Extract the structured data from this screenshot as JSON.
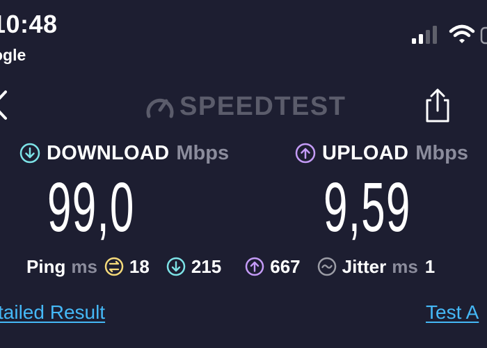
{
  "status_bar": {
    "time": "10:48",
    "carrier": "ogle"
  },
  "header": {
    "logo_text": "SPEEDTEST"
  },
  "download": {
    "title": "DOWNLOAD",
    "unit": "Mbps",
    "value": "99,0",
    "color": "#7de3e7"
  },
  "upload": {
    "title": "UPLOAD",
    "unit": "Mbps",
    "value": "9,59",
    "color": "#c49bf7"
  },
  "stats": {
    "ping_label": "Ping",
    "ping_unit": "ms",
    "ping_idle": "18",
    "ping_download": "215",
    "ping_upload": "667",
    "jitter_label": "Jitter",
    "jitter_unit": "ms",
    "jitter_value": "1",
    "idle_color": "#f5da7a"
  },
  "links": {
    "detailed_result": "tailed Result",
    "test_again": "Test A"
  },
  "icons": {
    "back": "chevron-left-icon",
    "logo": "gauge-icon",
    "share": "share-icon",
    "download": "arrow-down-circle-icon",
    "upload": "arrow-up-circle-icon",
    "idle": "idle-latency-icon",
    "jitter": "wave-icon"
  }
}
